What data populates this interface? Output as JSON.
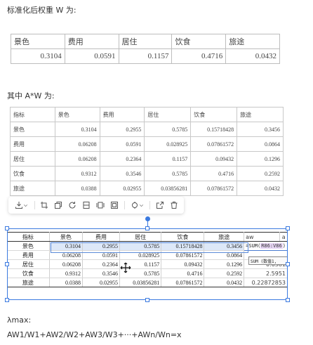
{
  "heading_weights": "标准化后权重 W 为:",
  "weights_table": {
    "headers": [
      "景色",
      "费用",
      "居住",
      "饮食",
      "旅途"
    ],
    "values": [
      "0.3104",
      "0.0591",
      "0.1157",
      "0.4716",
      "0.0432"
    ]
  },
  "heading_aw": "其中 A*W 为:",
  "aw_table": {
    "headers": [
      "指标",
      "景色",
      "费用",
      "居住",
      "饮食",
      "旅途"
    ],
    "rows": [
      {
        "label": "景色",
        "cells": [
          "0.3104",
          "0.2955",
          "0.5785",
          "0.15718428",
          "0.3456"
        ]
      },
      {
        "label": "费用",
        "cells": [
          "0.06208",
          "0.0591",
          "0.028925",
          "0.07861572",
          "0.0864"
        ]
      },
      {
        "label": "居住",
        "cells": [
          "0.06208",
          "0.2364",
          "0.1157",
          "0.09432",
          "0.1296"
        ]
      },
      {
        "label": "饮食",
        "cells": [
          "0.9312",
          "0.3546",
          "0.5785",
          "0.4716",
          "0.2592"
        ]
      },
      {
        "label": "旅途",
        "cells": [
          "0.0388",
          "0.02955",
          "0.03856281",
          "0.07861572",
          "0.0432"
        ]
      }
    ]
  },
  "toolbar": {
    "icons": [
      "download-icon",
      "crop-icon",
      "copy-icon",
      "rotate-icon",
      "split-icon",
      "frame-icon",
      "border-icon",
      "flip-icon",
      "open-external-icon",
      "delete-icon"
    ]
  },
  "sheet": {
    "headers": [
      "指标",
      "景色",
      "费用",
      "居住",
      "饮食",
      "旅途",
      "aw",
      "a"
    ],
    "formula_prefix": "=SUM(",
    "formula_ref": "R86:V86",
    "formula_suffix": ")",
    "tooltip": "SUM (数值1,",
    "rows": [
      {
        "label": "景色",
        "cells": [
          "0.3104",
          "0.2955",
          "0.5785",
          "0.15718428",
          "0.3456"
        ],
        "aw": ""
      },
      {
        "label": "费用",
        "cells": [
          "0.06208",
          "0.0591",
          "0.028925",
          "0.07861572",
          "0.0864"
        ],
        "aw": ""
      },
      {
        "label": "居住",
        "cells": [
          "0.06208",
          "0.2364",
          "0.1157",
          "0.09432",
          "0.1296"
        ],
        "aw": "0.6381"
      },
      {
        "label": "饮食",
        "cells": [
          "0.9312",
          "0.3546",
          "0.5785",
          "0.4716",
          "0.2592"
        ],
        "aw": "2.5951"
      },
      {
        "label": "旅途",
        "cells": [
          "0.0388",
          "0.02955",
          "0.03856281",
          "0.07861572",
          "0.0432"
        ],
        "aw": "0.22872853"
      }
    ]
  },
  "lambda_label": "λmax:",
  "formula_line": "AW1/W1+AW2/W2+AW3/W3+···+AWn/Wn=x",
  "colors": {
    "accent": "#3b7ae0",
    "selection_fill": "#dde8f8",
    "ref_highlight": "#e8d6f5"
  }
}
